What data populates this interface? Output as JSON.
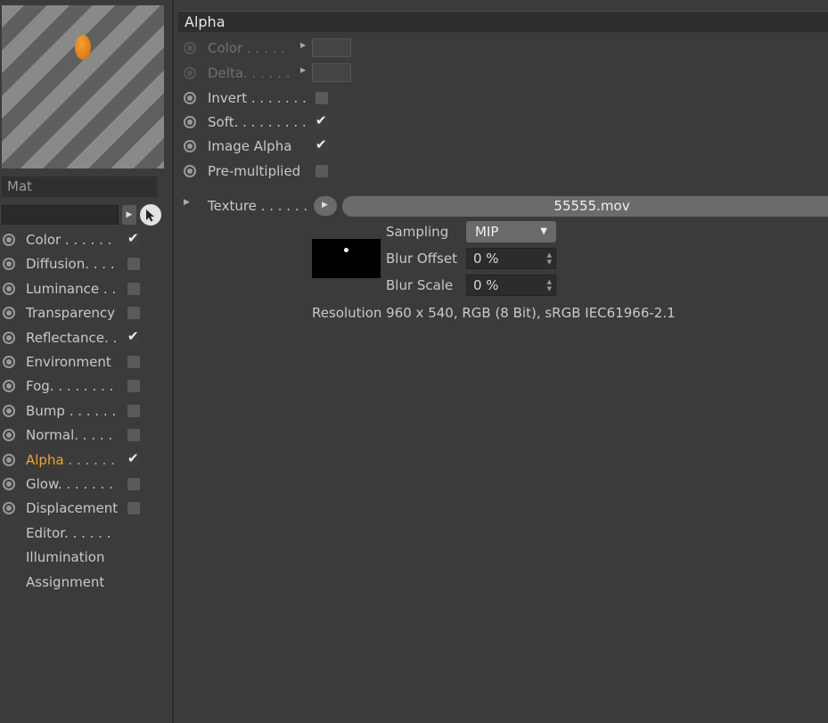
{
  "sidebar": {
    "material_name": "Mat",
    "search_value": "",
    "channels": [
      {
        "label": "Color . . . . . .",
        "has_radio": true,
        "has_checkbox": true,
        "checked": true,
        "active": false
      },
      {
        "label": "Diffusion. . . .",
        "has_radio": true,
        "has_checkbox": true,
        "checked": false,
        "active": false
      },
      {
        "label": "Luminance . .",
        "has_radio": true,
        "has_checkbox": true,
        "checked": false,
        "active": false
      },
      {
        "label": "Transparency",
        "has_radio": true,
        "has_checkbox": true,
        "checked": false,
        "active": false
      },
      {
        "label": "Reflectance. .",
        "has_radio": true,
        "has_checkbox": true,
        "checked": true,
        "active": false
      },
      {
        "label": "Environment",
        "has_radio": true,
        "has_checkbox": true,
        "checked": false,
        "active": false
      },
      {
        "label": "Fog. . . . . . . .",
        "has_radio": true,
        "has_checkbox": true,
        "checked": false,
        "active": false
      },
      {
        "label": "Bump . . . . . .",
        "has_radio": true,
        "has_checkbox": true,
        "checked": false,
        "active": false
      },
      {
        "label": "Normal. . . . .",
        "has_radio": true,
        "has_checkbox": true,
        "checked": false,
        "active": false
      },
      {
        "label": "Alpha . . . . . .",
        "has_radio": true,
        "has_checkbox": true,
        "checked": true,
        "active": true
      },
      {
        "label": "Glow. . . . . . .",
        "has_radio": true,
        "has_checkbox": true,
        "checked": false,
        "active": false
      },
      {
        "label": "Displacement",
        "has_radio": true,
        "has_checkbox": true,
        "checked": false,
        "active": false
      },
      {
        "label": "Editor. . . . . .",
        "has_radio": false,
        "has_checkbox": false,
        "checked": false,
        "active": false
      },
      {
        "label": "Illumination",
        "has_radio": false,
        "has_checkbox": false,
        "checked": false,
        "active": false
      },
      {
        "label": "Assignment",
        "has_radio": false,
        "has_checkbox": false,
        "checked": false,
        "active": false
      }
    ]
  },
  "alpha": {
    "section_title": "Alpha",
    "color_label": "Color . . . . .",
    "delta_label": "Delta. . . . . .",
    "invert_label": "Invert . . . . . . .",
    "invert_checked": false,
    "soft_label": "Soft. . . . . . . . .",
    "soft_checked": true,
    "image_alpha_label": "Image Alpha",
    "image_alpha_checked": true,
    "premultiplied_label": "Pre-multiplied",
    "premultiplied_checked": false,
    "texture_label": "Texture . . . . . .",
    "texture_file": "55555.mov",
    "sampling_label": "Sampling",
    "sampling_value": "MIP",
    "blur_offset_label": "Blur Offset",
    "blur_offset_value": "0 %",
    "blur_scale_label": "Blur Scale",
    "blur_scale_value": "0 %",
    "resolution_text": "Resolution 960 x 540, RGB (8 Bit), sRGB IEC61966-2.1"
  },
  "colors": {
    "active_channel": "#f1a32a",
    "panel_bg": "#3b3b3b",
    "header_bg": "#2e2e2e"
  }
}
